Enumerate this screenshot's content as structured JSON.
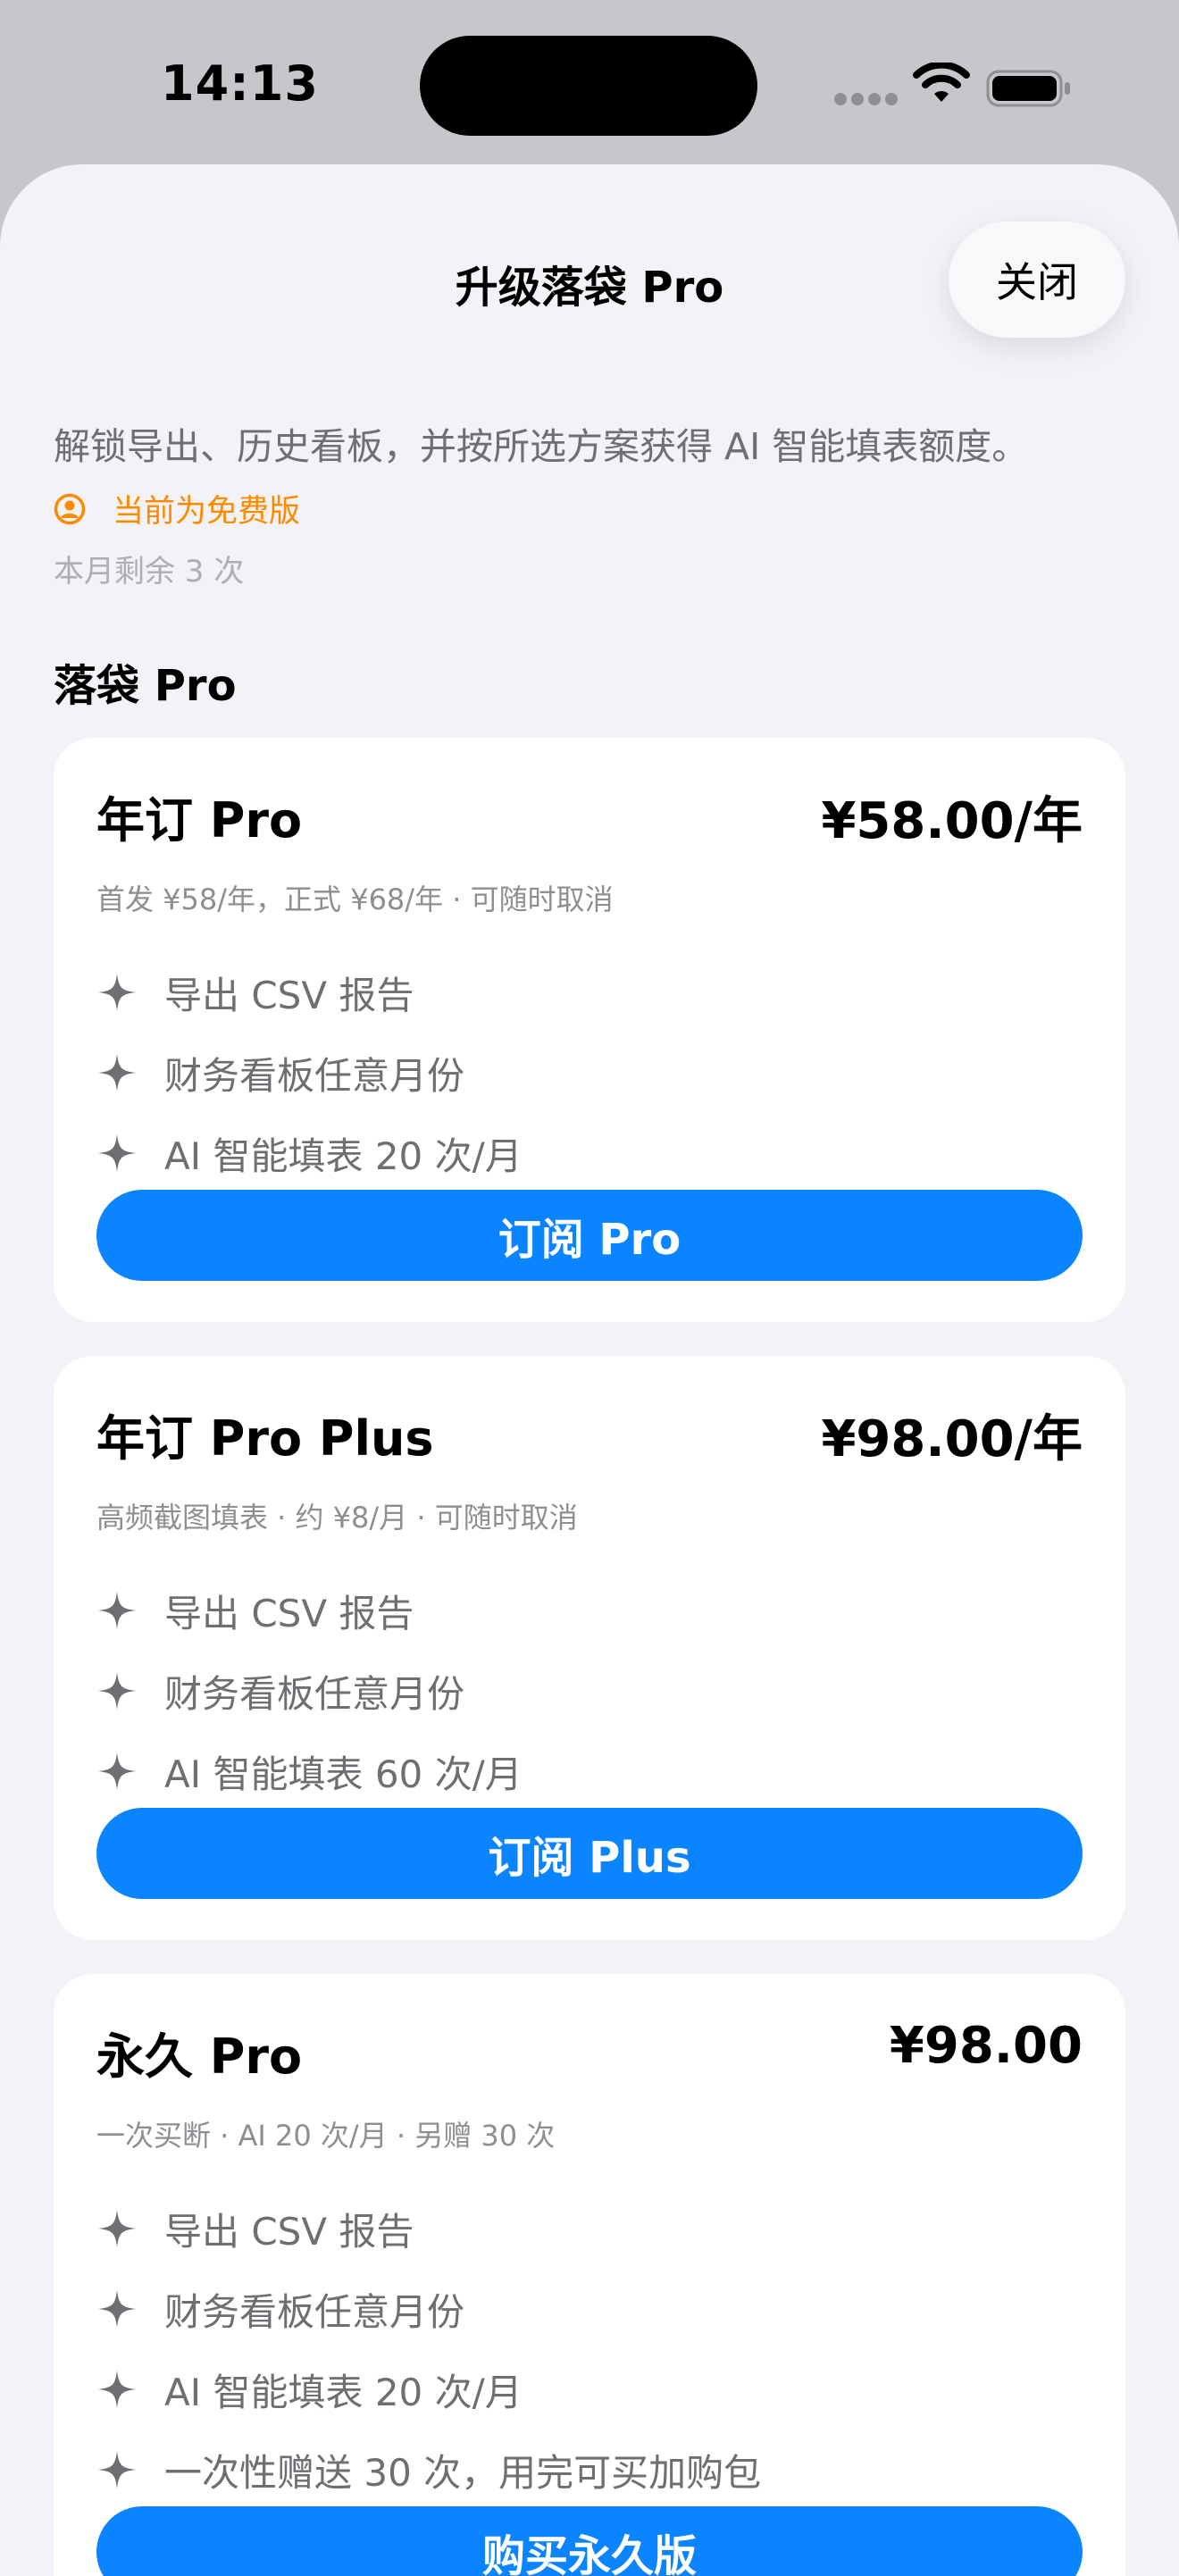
{
  "status_bar": {
    "time": "14:13",
    "icons": [
      "cellular-dots-icon",
      "wifi-icon",
      "battery-icon"
    ]
  },
  "sheet": {
    "title": "升级落袋 Pro",
    "close_label": "关闭",
    "intro": "解锁导出、历史看板，并按所选方案获得 AI 智能填表额度。",
    "current_status": "当前为免费版",
    "remaining": "本月剩余 3 次",
    "section_title": "落袋 Pro"
  },
  "plans": [
    {
      "name": "年订 Pro",
      "price": "¥58.00/年",
      "subtitle": "首发 ¥58/年，正式 ¥68/年 · 可随时取消",
      "features": [
        "导出 CSV 报告",
        "财务看板任意月份",
        "AI 智能填表 20 次/月"
      ],
      "cta": "订阅 Pro"
    },
    {
      "name": "年订 Pro Plus",
      "price": "¥98.00/年",
      "subtitle": "高频截图填表 · 约 ¥8/月 · 可随时取消",
      "features": [
        "导出 CSV 报告",
        "财务看板任意月份",
        "AI 智能填表 60 次/月"
      ],
      "cta": "订阅 Plus"
    },
    {
      "name": "永久 Pro",
      "price": "¥98.00",
      "subtitle": "一次买断 · AI 20 次/月 · 另赠 30 次",
      "features": [
        "导出 CSV 报告",
        "财务看板任意月份",
        "AI 智能填表 20 次/月",
        "一次性赠送 30 次，用完可买加购包"
      ],
      "cta": "购买永久版"
    }
  ],
  "colors": {
    "accent": "#0a84ff",
    "status_orange": "#ff8a00",
    "sheet_background": "#f2f2f7",
    "card_background": "#ffffff",
    "secondary_text": "#6e6e73"
  }
}
